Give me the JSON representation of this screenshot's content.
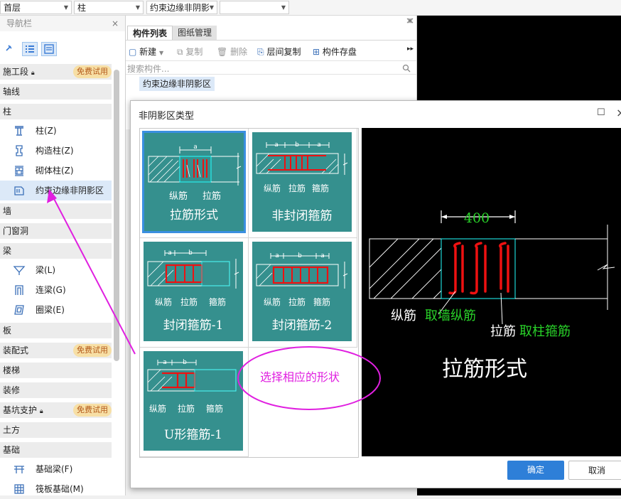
{
  "toolbar": {
    "floor": "首层",
    "category": "柱",
    "component": "约束边缘非阴影",
    "extra": ""
  },
  "nav": {
    "title": "导航栏",
    "close": "×",
    "categories": {
      "sgd": {
        "label": "施工段",
        "badge": "免费试用"
      },
      "zx": {
        "label": "轴线"
      },
      "zhu": {
        "label": "柱"
      },
      "qiang": {
        "label": "墙"
      },
      "mcd": {
        "label": "门窗洞"
      },
      "liang": {
        "label": "梁"
      },
      "ban": {
        "label": "板"
      },
      "zps": {
        "label": "装配式",
        "badge": "免费试用"
      },
      "lt": {
        "label": "楼梯"
      },
      "zx2": {
        "label": "装修"
      },
      "jkzh": {
        "label": "基坑支护",
        "badge": "免费试用"
      },
      "tf": {
        "label": "土方"
      },
      "jc": {
        "label": "基础"
      }
    },
    "items": {
      "zhu": "柱(Z)",
      "gzz": "构造柱(Z)",
      "qtz": "砌体柱(Z)",
      "ysby": "约束边缘非阴影区(Z",
      "liang": "梁(L)",
      "ll": "连梁(G)",
      "ql": "圈梁(E)",
      "jcl": "基础梁(F)",
      "fbjc": "筏板基础(M)"
    }
  },
  "components": {
    "tabs": [
      "构件列表",
      "图纸管理"
    ],
    "buttons": {
      "new": "新建",
      "copy": "复制",
      "delete": "删除",
      "floor_copy": "层间复制",
      "save": "构件存盘"
    },
    "search_placeholder": "搜索构件...",
    "selected": "约束边缘非阴影区"
  },
  "dialog": {
    "title": "非阴影区类型",
    "max": "☐",
    "close": "×",
    "options": [
      {
        "label": "拉筋形式",
        "tags": [
          "纵筋",
          "拉筋"
        ]
      },
      {
        "label": "非封闭箍筋",
        "tags": [
          "纵筋",
          "拉筋",
          "箍筋"
        ]
      },
      {
        "label": "封闭箍筋-1",
        "tags": [
          "纵筋",
          "拉筋",
          "箍筋"
        ]
      },
      {
        "label": "封闭箍筋-2",
        "tags": [
          "纵筋",
          "拉筋",
          "箍筋"
        ]
      },
      {
        "label": "U形箍筋-1",
        "tags": [
          "纵筋",
          "拉筋",
          "箍筋"
        ]
      }
    ],
    "dims": {
      "a": "a",
      "b": "b"
    },
    "preview": {
      "dimension": "400",
      "long_label": "纵筋",
      "long_note": "取墙纵筋",
      "tie_label": "拉筋",
      "tie_note": "取柱箍筋",
      "caption": "拉筋形式"
    },
    "ok": "确定",
    "cancel": "取消"
  },
  "annotation": {
    "text": "选择相应的形状",
    "color": "#e020e0"
  }
}
